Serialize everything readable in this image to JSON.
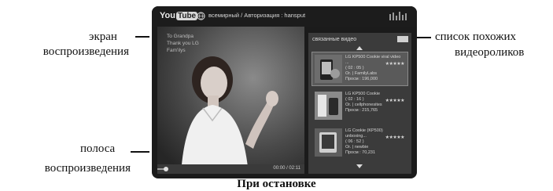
{
  "labels": {
    "screen_line1": "экран",
    "screen_line2": "воспроизведения",
    "related_line1": "список похожих",
    "related_line2": "видеороликов",
    "bar_line1": "полоса",
    "bar_line2": "воспроизведения"
  },
  "screen": {
    "logo_you": "You",
    "logo_tube": "Tube",
    "region_text": "всемирный / Авторизация : hansput",
    "related_title": "связанные видео",
    "overlay_lines": [
      "To Grandpa",
      "Thank you LG",
      "Fam'ilys"
    ],
    "time": "00:00 / 02:11",
    "items": [
      {
        "title": "LG KP500 Cookie viral video ...",
        "meta1": "( 02 : 05 )",
        "meta2": "Or. | FamilyLabs",
        "meta3": "Просм : 196,000",
        "stars": "★★★★★"
      },
      {
        "title": "LG KP500 Cookie",
        "meta1": "( 02 : 16 )",
        "meta2": "Or. | cellphonesites",
        "meta3": "Просм : 215,765",
        "stars": "★★★★★"
      },
      {
        "title": "LG Cookie (KP500) unboxing...",
        "meta1": "( 06 : 52 )",
        "meta2": "Or. | newbie",
        "meta3": "Просм : 70,231",
        "stars": "★★★★★"
      }
    ]
  },
  "caption": "При остановке",
  "playback_progress_percent": 5,
  "colors": {
    "screen_bg": "#1b1b1b",
    "panel_bg": "#3b3b3b",
    "text": "#111111"
  }
}
